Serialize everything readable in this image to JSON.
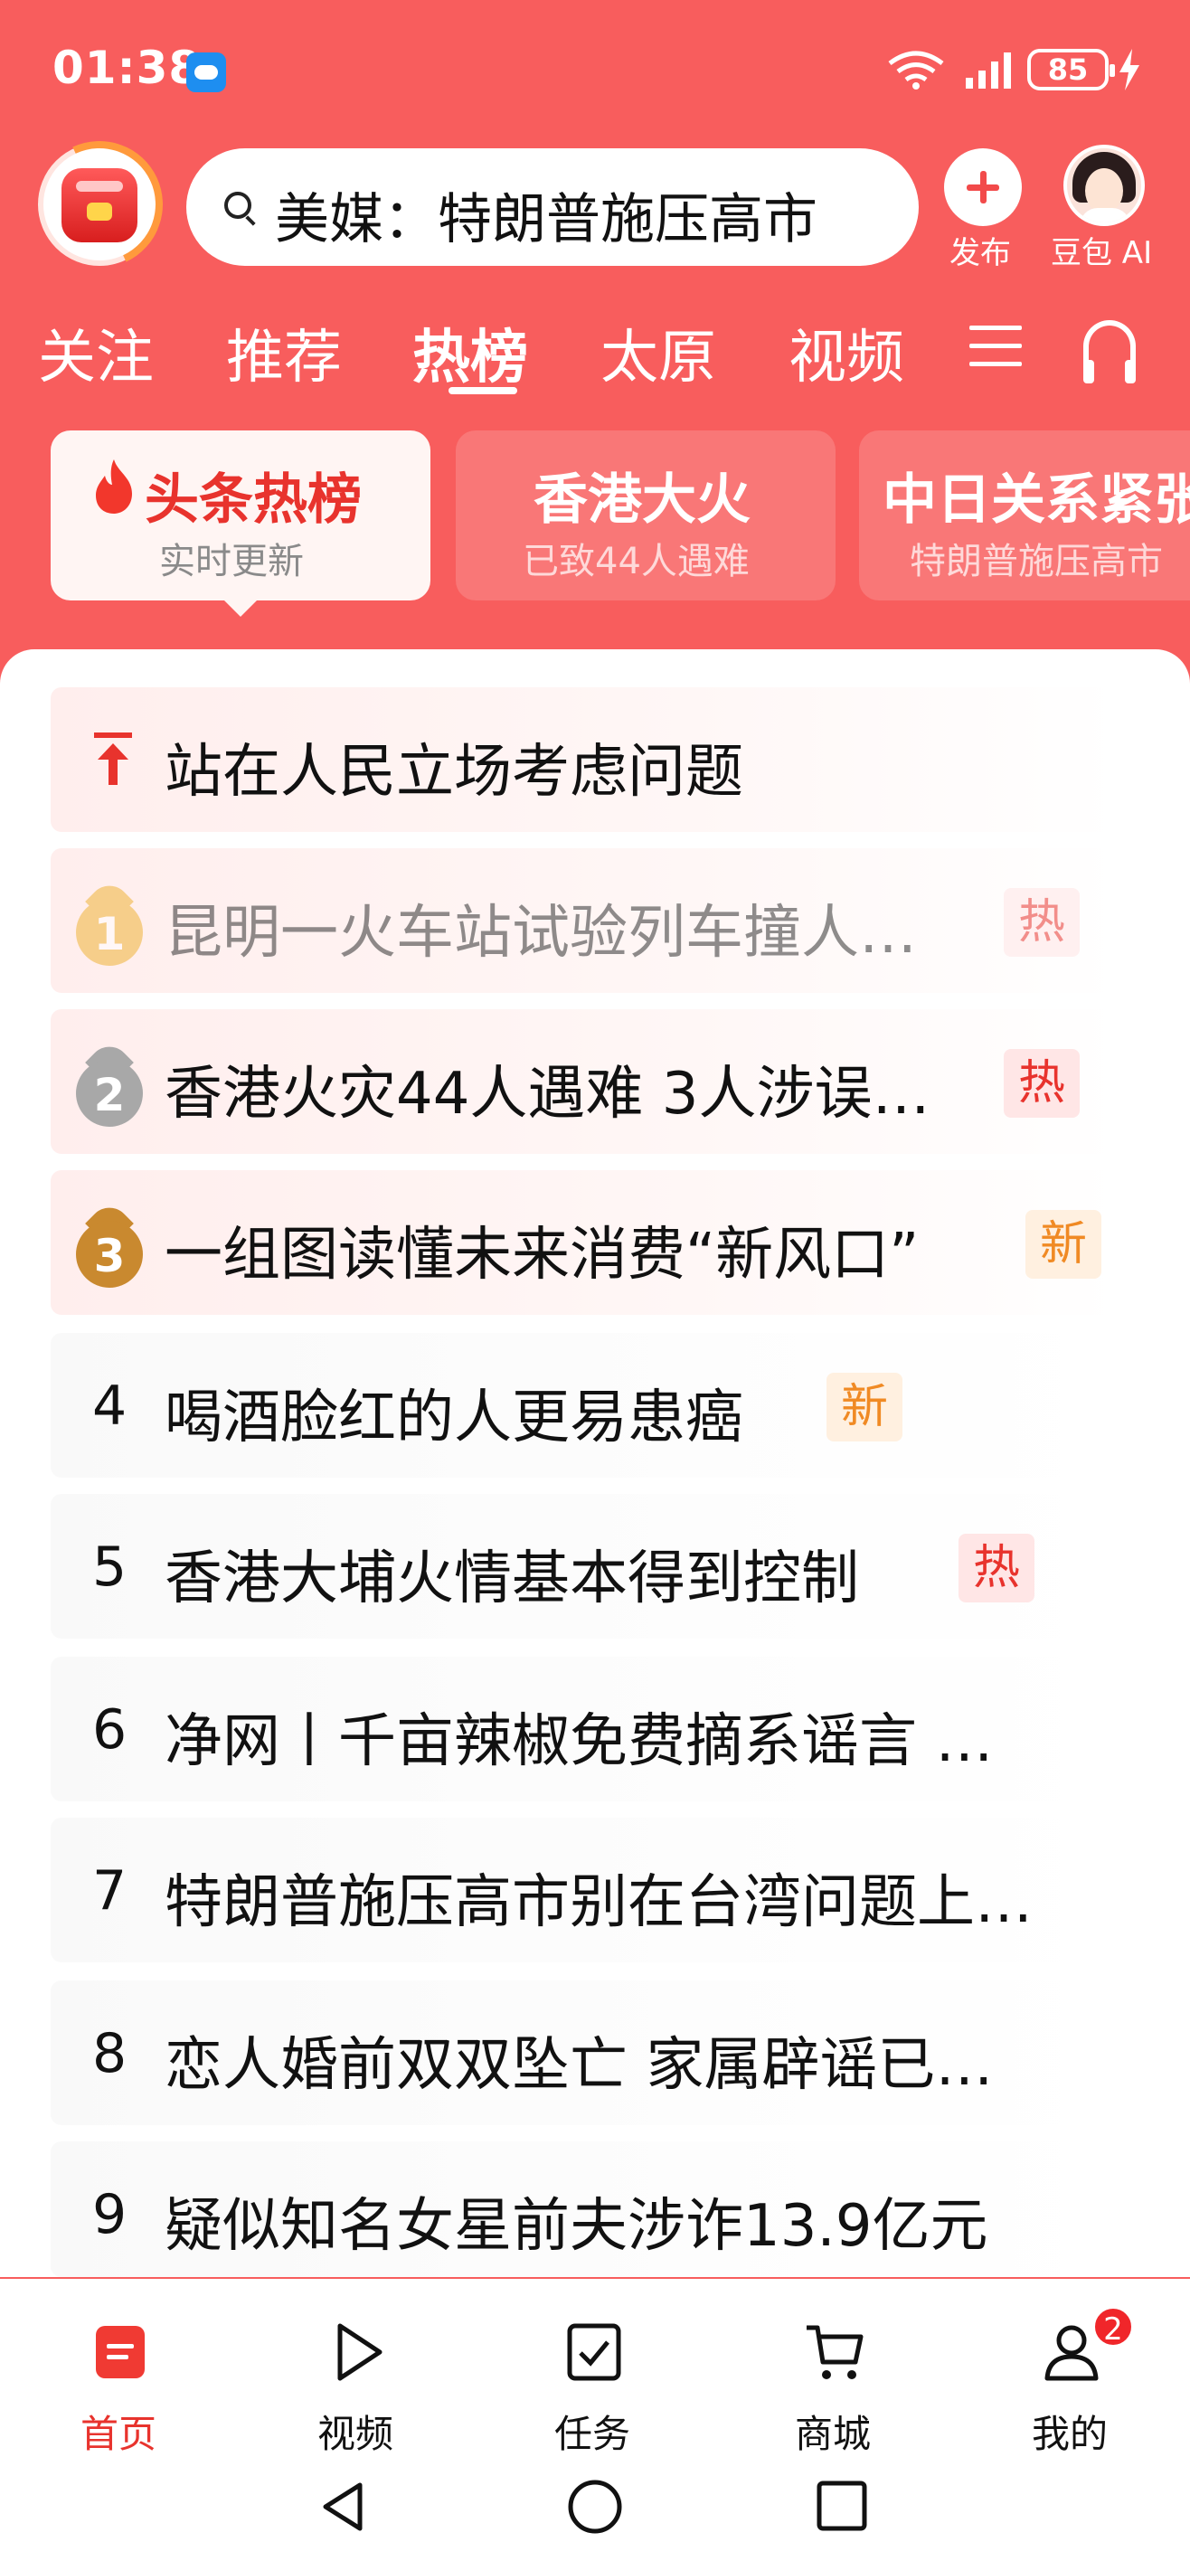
{
  "status_bar": {
    "time": "01:38",
    "battery": "85",
    "icons": [
      "weather-icon",
      "wifi-icon",
      "signal-icon",
      "battery-icon",
      "charging-icon"
    ]
  },
  "header": {
    "search_text": "美媒：特朗普施压高市",
    "publish_label": "发布",
    "doubao_label": "豆包 AI"
  },
  "tabs": [
    {
      "label": "关注",
      "active": false
    },
    {
      "label": "推荐",
      "active": false
    },
    {
      "label": "热榜",
      "active": true
    },
    {
      "label": "太原",
      "active": false
    },
    {
      "label": "视频",
      "active": false
    }
  ],
  "topic_cards": [
    {
      "title": "头条热榜",
      "subtitle": "实时更新",
      "active": true
    },
    {
      "title": "香港大火",
      "subtitle": "已致44人遇难",
      "active": false
    },
    {
      "title": "中日关系紧张",
      "subtitle": "特朗普施压高市",
      "active": false
    }
  ],
  "hot_list": [
    {
      "rank": "pin",
      "title": "站在人民立场考虑问题",
      "tag": ""
    },
    {
      "rank": "1",
      "title": "昆明一火车站试验列车撞人…",
      "tag": "热"
    },
    {
      "rank": "2",
      "title": "香港火灾44人遇难 3人涉误…",
      "tag": "热"
    },
    {
      "rank": "3",
      "title": "一组图读懂未来消费“新风口”",
      "tag": "新"
    },
    {
      "rank": "4",
      "title": "喝酒脸红的人更易患癌",
      "tag": "新"
    },
    {
      "rank": "5",
      "title": "香港大埔火情基本得到控制",
      "tag": "热"
    },
    {
      "rank": "6",
      "title": "净网丨千亩辣椒免费摘系谣言 …",
      "tag": ""
    },
    {
      "rank": "7",
      "title": "特朗普施压高市别在台湾问题上…",
      "tag": ""
    },
    {
      "rank": "8",
      "title": "恋人婚前双双坠亡 家属辟谣已…",
      "tag": ""
    },
    {
      "rank": "9",
      "title": "疑似知名女星前夫涉诈13.9亿元",
      "tag": ""
    }
  ],
  "bottom_nav": [
    {
      "label": "首页",
      "icon": "home-icon",
      "active": true
    },
    {
      "label": "视频",
      "icon": "play-icon",
      "active": false
    },
    {
      "label": "任务",
      "icon": "task-icon",
      "active": false
    },
    {
      "label": "商城",
      "icon": "cart-icon",
      "active": false
    },
    {
      "label": "我的",
      "icon": "profile-icon",
      "active": false,
      "badge": "2"
    }
  ],
  "colors": {
    "brand_red": "#f85d5d",
    "accent_red": "#e8332d",
    "gold": "#f0b43a",
    "silver": "#a8a8a8",
    "bronze": "#c9892f",
    "new_orange": "#f08a24"
  }
}
